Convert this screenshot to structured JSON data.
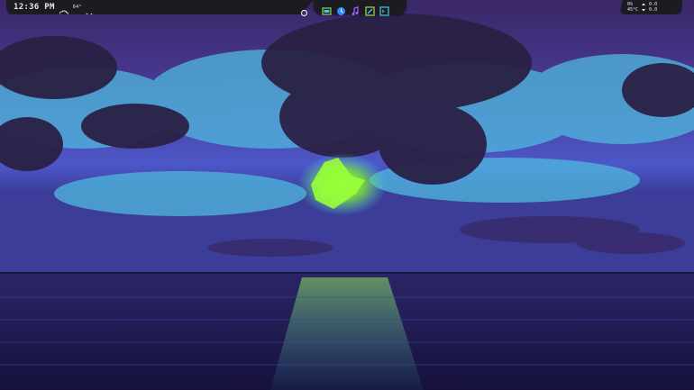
{
  "wallpaper": {
    "sky_top_color": "#3b2a6a",
    "sky_mid_color": "#4a3aa0",
    "horizon_color": "#4b5bd0",
    "sea_color": "#231c52",
    "glow_color": "#8dff3c",
    "cloud_dark_color": "#2a2040",
    "cloud_cyan_color": "#46c7e8"
  },
  "top_bar": {
    "clock": "12:36 PM",
    "weather_icon": "cloud-icon",
    "weather_temp": "64°",
    "dropdown_icon": "chevron-down-icon"
  },
  "dock": {
    "activities_icon": "circle-icon",
    "apps": [
      {
        "name": "files-icon",
        "color": "#7ed957"
      },
      {
        "name": "browser-icon",
        "color": "#2e8cff"
      },
      {
        "name": "music-icon",
        "color": "#a05cff"
      },
      {
        "name": "editor-icon",
        "color": "#9ee04a"
      },
      {
        "name": "terminal-icon",
        "color": "#46c7e8"
      }
    ]
  },
  "system_stats": {
    "cpu": "0%",
    "temp": "45°C",
    "net_up": "0.0",
    "net_down": "0.0"
  }
}
